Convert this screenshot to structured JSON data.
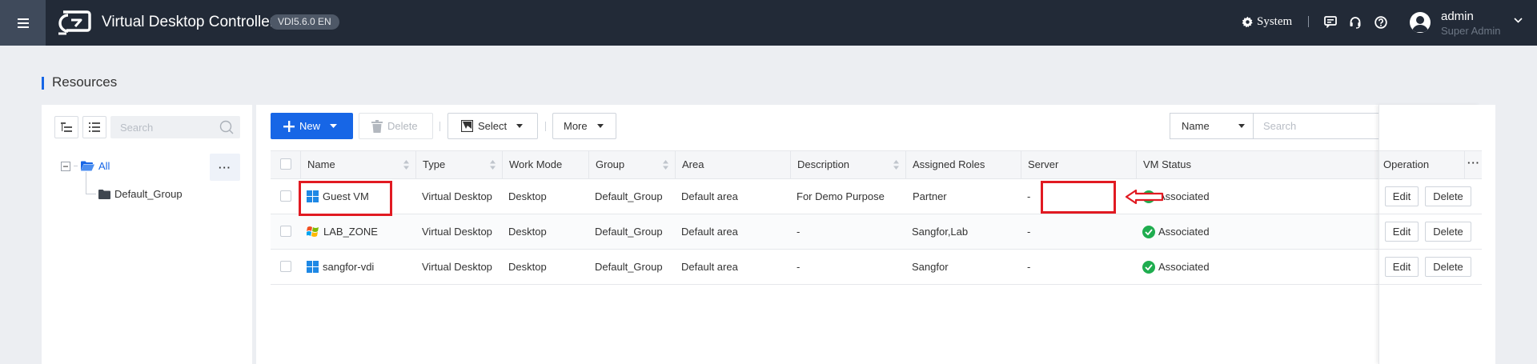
{
  "header": {
    "app_title": "Virtual Desktop Controller",
    "version": "VDI5.6.0 EN",
    "system_label": "System",
    "user_name": "admin",
    "user_role": "Super Admin"
  },
  "page": {
    "title": "Resources"
  },
  "tree": {
    "search_placeholder": "Search",
    "root_label": "All",
    "more_label": "···",
    "children": [
      "Default_Group"
    ]
  },
  "toolbar": {
    "new_label": "New",
    "delete_label": "Delete",
    "select_label": "Select",
    "more_label": "More",
    "filter_field": "Name",
    "search_placeholder": "Search"
  },
  "table": {
    "columns": [
      "Name",
      "Type",
      "Work Mode",
      "Group",
      "Area",
      "Description",
      "Assigned Roles",
      "Server",
      "VM Status",
      "Operation"
    ],
    "column_menu": "···",
    "rows": [
      {
        "name": "Guest VM",
        "os": "windows10",
        "type": "Virtual Desktop",
        "work_mode": "Desktop",
        "group": "Default_Group",
        "area": "Default area",
        "description": "For Demo Purpose",
        "roles": "Partner",
        "server": "-",
        "status": "Associated"
      },
      {
        "name": "LAB_ZONE",
        "os": "windows-xp",
        "type": "Virtual Desktop",
        "work_mode": "Desktop",
        "group": "Default_Group",
        "area": "Default area",
        "description": "-",
        "roles": "Sangfor,Lab",
        "server": "-",
        "status": "Associated"
      },
      {
        "name": "sangfor-vdi",
        "os": "windows10",
        "type": "Virtual Desktop",
        "work_mode": "Desktop",
        "group": "Default_Group",
        "area": "Default area",
        "description": "-",
        "roles": "Sangfor",
        "server": "-",
        "status": "Associated"
      }
    ],
    "edit_label": "Edit",
    "delete_label": "Delete"
  },
  "colors": {
    "topbar": "#222a37",
    "accent": "#1766e6",
    "highlight": "#e11a22",
    "status_ok": "#1fad4f"
  }
}
